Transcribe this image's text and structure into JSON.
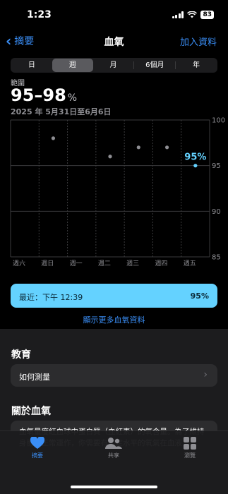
{
  "status": {
    "time": "1:23",
    "battery": "83"
  },
  "nav": {
    "back_label": "摘要",
    "title": "血氧",
    "add_label": "加入資料"
  },
  "segments": [
    {
      "label": "日",
      "selected": false
    },
    {
      "label": "週",
      "selected": true
    },
    {
      "label": "月",
      "selected": false
    },
    {
      "label": "6個月",
      "selected": false
    },
    {
      "label": "年",
      "selected": false
    }
  ],
  "summary": {
    "range_label": "範圍",
    "range_value": "95–98",
    "unit": "%",
    "date_range": "2025 年 5月31日至6月6日"
  },
  "chart_data": {
    "type": "scatter",
    "categories": [
      "週六",
      "週日",
      "週一",
      "週二",
      "週三",
      "週四",
      "週五"
    ],
    "values": [
      null,
      98,
      null,
      96,
      97,
      97,
      95
    ],
    "y_ticks": [
      85,
      90,
      95,
      100
    ],
    "ylim": [
      85,
      100
    ],
    "highlight": {
      "index": 6,
      "label": "95%"
    },
    "colors": {
      "point": "#8e8e93",
      "highlight": "#64d2ff",
      "grid": "#3a3a3c"
    }
  },
  "latest": {
    "label": "最近：下午 12:39",
    "value": "95%"
  },
  "more_link": "顯示更多血氧資料",
  "education": {
    "title": "教育",
    "item": "如何測量"
  },
  "about": {
    "title": "關於血氧",
    "text": "血氧量度紅血球中蛋白質（血紅素）的氧含量。為了維持身體的正常運作，你需要有一定水平的氧氣在血液"
  },
  "tabbar": {
    "items": [
      {
        "label": "摘要",
        "icon": "heart-icon",
        "active": true
      },
      {
        "label": "共享",
        "icon": "people-icon",
        "active": false
      },
      {
        "label": "瀏覽",
        "icon": "grid-icon",
        "active": false
      }
    ],
    "active_color": "#3a8ef6"
  }
}
